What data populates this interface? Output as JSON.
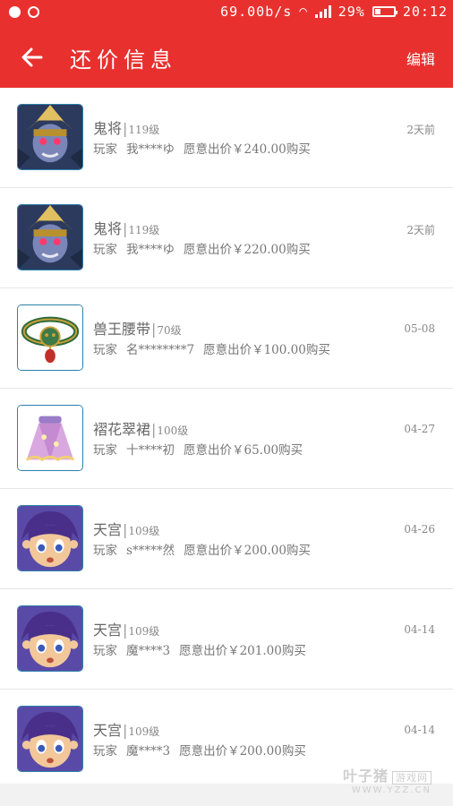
{
  "status_bar": {
    "speed": "69.00b/s",
    "battery": "29%",
    "battery_level": 0.29,
    "time": "20:12"
  },
  "header": {
    "title": "还价信息",
    "edit_label": "编辑"
  },
  "items": [
    {
      "name": "鬼将",
      "level": "119级",
      "player_label": "玩家",
      "player": "我****ゆ",
      "offer_text": "愿意出价￥240.00购买",
      "time": "2天前",
      "icon": "ghost-general-avatar-icon"
    },
    {
      "name": "鬼将",
      "level": "119级",
      "player_label": "玩家",
      "player": "我****ゆ",
      "offer_text": "愿意出价￥220.00购买",
      "time": "2天前",
      "icon": "ghost-general-avatar-icon"
    },
    {
      "name": "兽王腰带",
      "level": "70级",
      "player_label": "玩家",
      "player": "名********7",
      "offer_text": "愿意出价￥100.00购买",
      "time": "05-08",
      "icon": "beast-king-belt-icon"
    },
    {
      "name": "褶花翠裙",
      "level": "100级",
      "player_label": "玩家",
      "player": "十****初",
      "offer_text": "愿意出价￥65.00购买",
      "time": "04-27",
      "icon": "flower-skirt-icon"
    },
    {
      "name": "天宫",
      "level": "109级",
      "player_label": "玩家",
      "player": "s*****然",
      "offer_text": "愿意出价￥200.00购买",
      "time": "04-26",
      "icon": "tiangong-avatar-icon"
    },
    {
      "name": "天宫",
      "level": "109级",
      "player_label": "玩家",
      "player": "魔****3",
      "offer_text": "愿意出价￥201.00购买",
      "time": "04-14",
      "icon": "tiangong-avatar-icon"
    },
    {
      "name": "天宫",
      "level": "109级",
      "player_label": "玩家",
      "player": "魔****3",
      "offer_text": "愿意出价￥200.00购买",
      "time": "04-14",
      "icon": "tiangong-avatar-icon"
    }
  ],
  "watermark": {
    "brand": "叶子猪",
    "tag": "游戏网",
    "url": "WWW.YZZ.CN"
  },
  "colors": {
    "accent": "#e8312f"
  }
}
